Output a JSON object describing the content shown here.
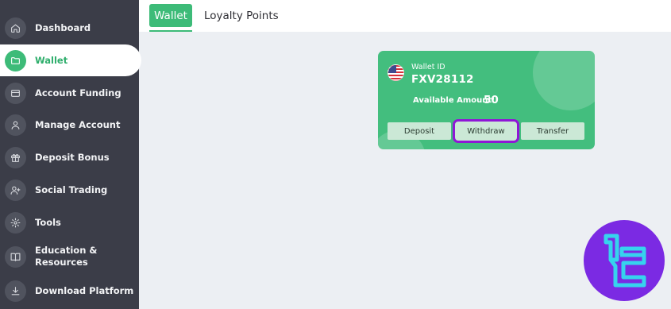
{
  "sidebar": {
    "items": [
      {
        "label": "Dashboard",
        "icon": "home-icon"
      },
      {
        "label": "Wallet",
        "icon": "folder-icon",
        "active": true
      },
      {
        "label": "Account Funding",
        "icon": "card-icon"
      },
      {
        "label": "Manage Account",
        "icon": "user-icon"
      },
      {
        "label": "Deposit Bonus",
        "icon": "gift-icon"
      },
      {
        "label": "Social Trading",
        "icon": "user-plus-icon"
      },
      {
        "label": "Tools",
        "icon": "gear-icon"
      },
      {
        "label": "Education &\nResources",
        "icon": "book-icon"
      },
      {
        "label": "Download Platform",
        "icon": "download-icon"
      }
    ]
  },
  "tabs": [
    {
      "label": "Wallet",
      "active": true
    },
    {
      "label": "Loyalty Points",
      "active": false
    }
  ],
  "wallet_card": {
    "id_label": "Wallet ID",
    "id_value": "FXV28112",
    "amount_label": "Available Amount:",
    "amount_value": "50",
    "flag_icon": "us-flag-icon",
    "buttons": {
      "deposit": "Deposit",
      "withdraw": "Withdraw",
      "transfer": "Transfer"
    }
  },
  "colors": {
    "accent": "#3dbb78",
    "sidebar_bg": "#3b3d48",
    "highlight": "#8f17d6",
    "logo_bg": "#7b2ae3"
  }
}
